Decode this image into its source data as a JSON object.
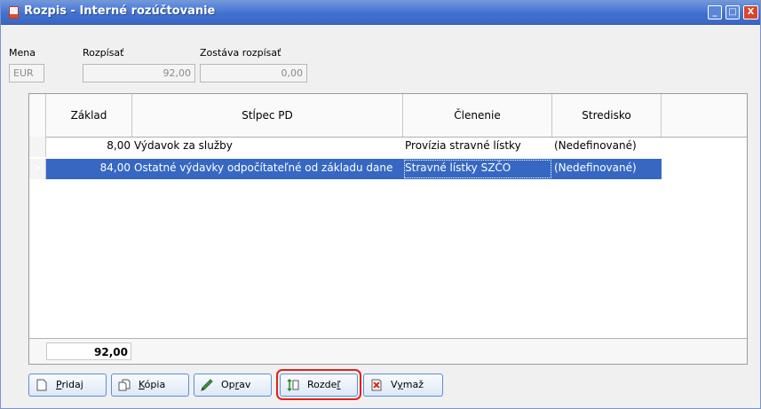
{
  "window": {
    "title": "Rozpis - Interné rozúčtovanie",
    "min_label": "_",
    "max_label": "□",
    "close_label": "X"
  },
  "fields": {
    "mena_label": "Mena",
    "mena_value": "EUR",
    "rozpisat_label": "Rozpísať",
    "rozpisat_value": "92,00",
    "zostava_label": "Zostáva rozpísať",
    "zostava_value": "0,00"
  },
  "grid": {
    "columns": [
      "Základ",
      "Stĺpec PD",
      "Členenie",
      "Stredisko"
    ],
    "rows": [
      {
        "indicator": "",
        "zaklad": "8,00",
        "stlpec": "Výdavok za služby",
        "clenenie": "Provízia stravné lístky",
        "stredisko": "(Nedefinované)"
      },
      {
        "indicator": ">",
        "zaklad": "84,00",
        "stlpec": "Ostatné výdavky odpočítateľné od základu dane",
        "clenenie": "Stravné lístky SZČO",
        "stredisko": "(Nedefinované)"
      }
    ],
    "total": "92,00"
  },
  "buttons": {
    "pridaj": {
      "ul": "P",
      "rest": "ridaj"
    },
    "kopia": {
      "ul": "K",
      "rest": "ópia"
    },
    "oprav": {
      "pre": "Op",
      "ul": "r",
      "rest": "av"
    },
    "rozdel": {
      "pre": "Rozde",
      "ul": "ľ",
      "rest": ""
    },
    "vymaz": {
      "pre": "V",
      "ul": "y",
      "rest": "maž"
    }
  },
  "colors": {
    "titlebar": "#4170cf",
    "selection": "#3668c3",
    "highlight": "#e0211b"
  }
}
